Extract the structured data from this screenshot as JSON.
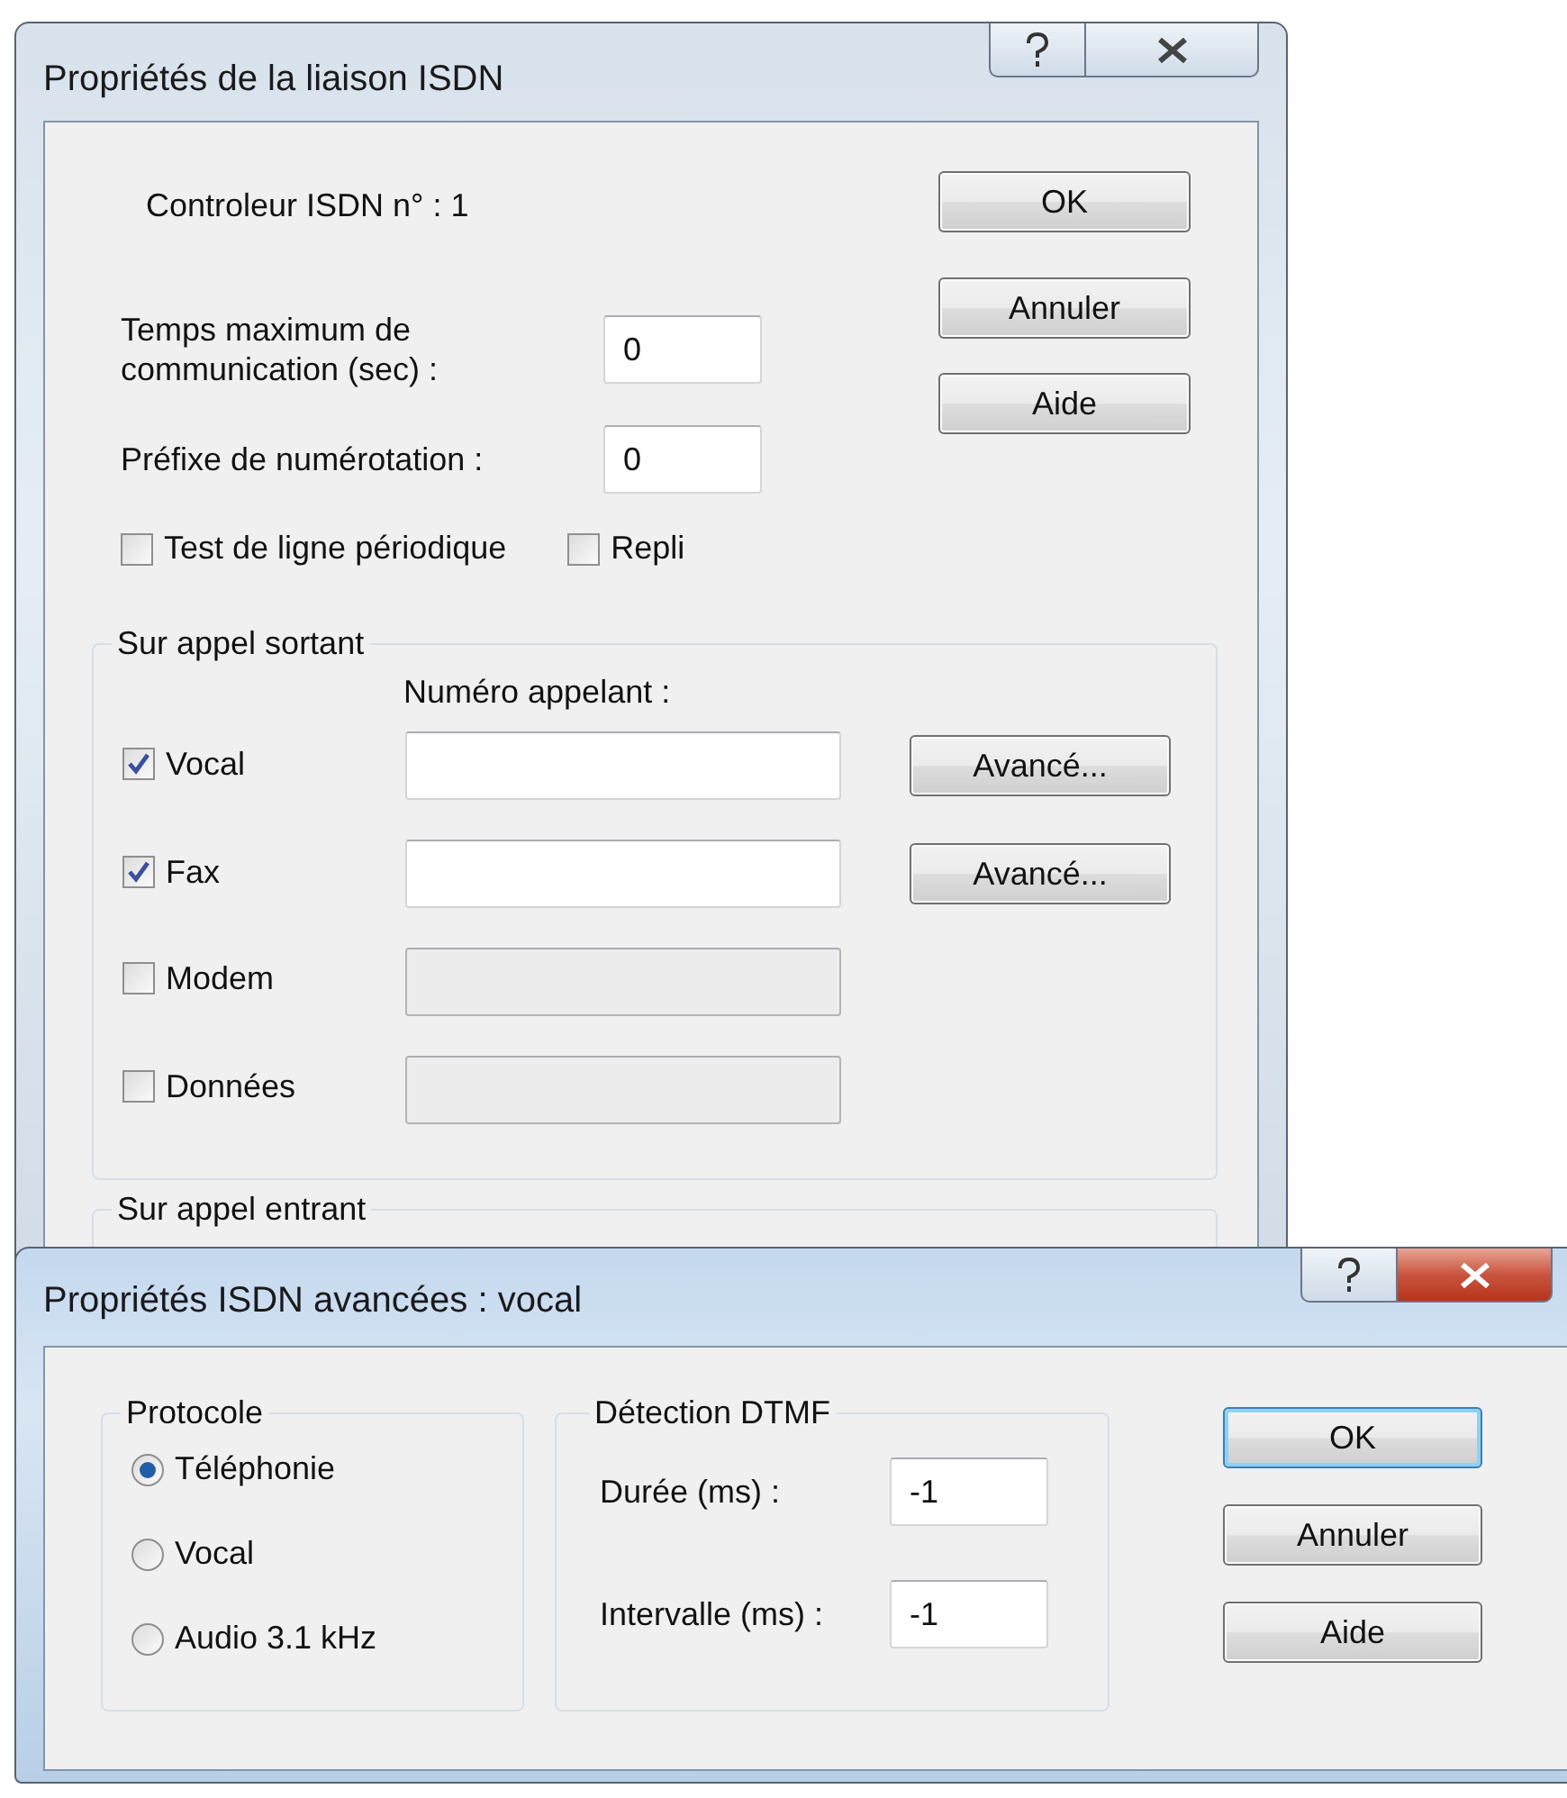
{
  "parent_dialog": {
    "title": "Propriétés de la liaison ISDN",
    "active": false,
    "controller_label": "Controleur ISDN n° : 1",
    "fields": [
      {
        "label": "Temps maximum de communication (sec) :",
        "value": "0"
      },
      {
        "label": "Préfixe de numérotation :",
        "value": "0"
      }
    ],
    "options": [
      {
        "label": "Test de ligne périodique",
        "checked": false
      },
      {
        "label": "Repli",
        "checked": false
      }
    ],
    "buttons": [
      "OK",
      "Annuler",
      "Aide"
    ],
    "outgoing_group": {
      "title": "Sur appel sortant",
      "column_label": "Numéro appelant :",
      "rows": [
        {
          "label": "Vocal",
          "checked": true,
          "button": "Avancé..."
        },
        {
          "label": "Fax",
          "checked": true,
          "button": "Avancé..."
        },
        {
          "label": "Modem",
          "checked": false
        },
        {
          "label": "Données",
          "checked": false
        }
      ]
    },
    "incoming_group": {
      "title": "Sur appel entrant"
    }
  },
  "advanced_dialog": {
    "title": "Propriétés ISDN avancées : vocal",
    "active": true,
    "protocol_group": {
      "title": "Protocole",
      "options": [
        {
          "label": "Téléphonie",
          "selected": true
        },
        {
          "label": "Vocal",
          "selected": false
        },
        {
          "label": "Audio 3.1 kHz",
          "selected": false
        }
      ]
    },
    "dtmf_group": {
      "title": "Détection DTMF",
      "fields": [
        {
          "label": "Durée (ms) :",
          "value": "-1"
        },
        {
          "label": "Intervalle (ms) :",
          "value": "-1"
        }
      ]
    },
    "buttons": [
      {
        "label": "OK",
        "focused": true
      },
      {
        "label": "Annuler",
        "focused": false
      },
      {
        "label": "Aide",
        "focused": false
      }
    ]
  }
}
